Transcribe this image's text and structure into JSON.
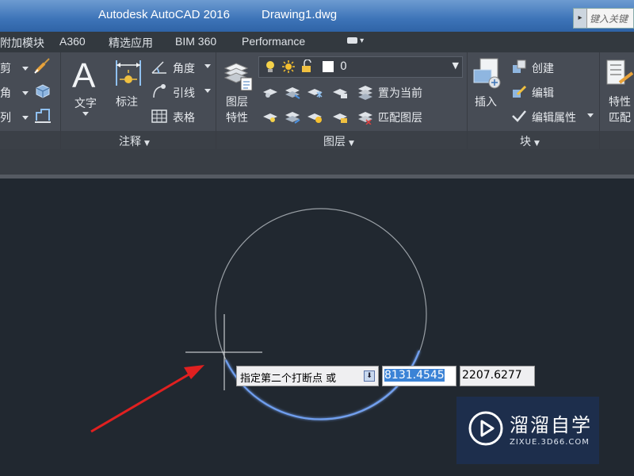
{
  "titlebar": {
    "app_title": "Autodesk AutoCAD 2016",
    "document": "Drawing1.dwg",
    "search_placeholder": "键入关键"
  },
  "tabs": [
    {
      "label": "附加模块"
    },
    {
      "label": "A360"
    },
    {
      "label": "精选应用"
    },
    {
      "label": "BIM 360"
    },
    {
      "label": "Performance"
    }
  ],
  "ribbon": {
    "left_partial": [
      "剪",
      "角",
      "列"
    ],
    "annotation": {
      "text_label": "文字",
      "dimension_label": "标注",
      "angle_label": "角度",
      "leader_label": "引线",
      "table_label": "表格",
      "panel_label": "注释"
    },
    "layers": {
      "props_label_1": "图层",
      "props_label_2": "特性",
      "current_layer": "0",
      "set_current_label": "置为当前",
      "match_layer_label": "匹配图层",
      "panel_label": "图层"
    },
    "block": {
      "insert_label": "插入",
      "create_label": "创建",
      "edit_label": "编辑",
      "edit_attr_label": "编辑属性",
      "panel_label": "块"
    },
    "properties": {
      "label_1": "特性",
      "label_2": "匹配"
    }
  },
  "command": {
    "prompt": "指定第二个打断点 或",
    "x_value": "8131.4545",
    "y_value": "2207.6277"
  },
  "watermark": {
    "brand": "溜溜自学",
    "url": "ZIXUE.3D66.COM"
  },
  "colors": {
    "canvas_bg": "#212830",
    "ribbon_bg": "#474c55",
    "titlebar": "#3d74b8",
    "arrow": "#e02020",
    "highlight": "#3b83d6"
  }
}
